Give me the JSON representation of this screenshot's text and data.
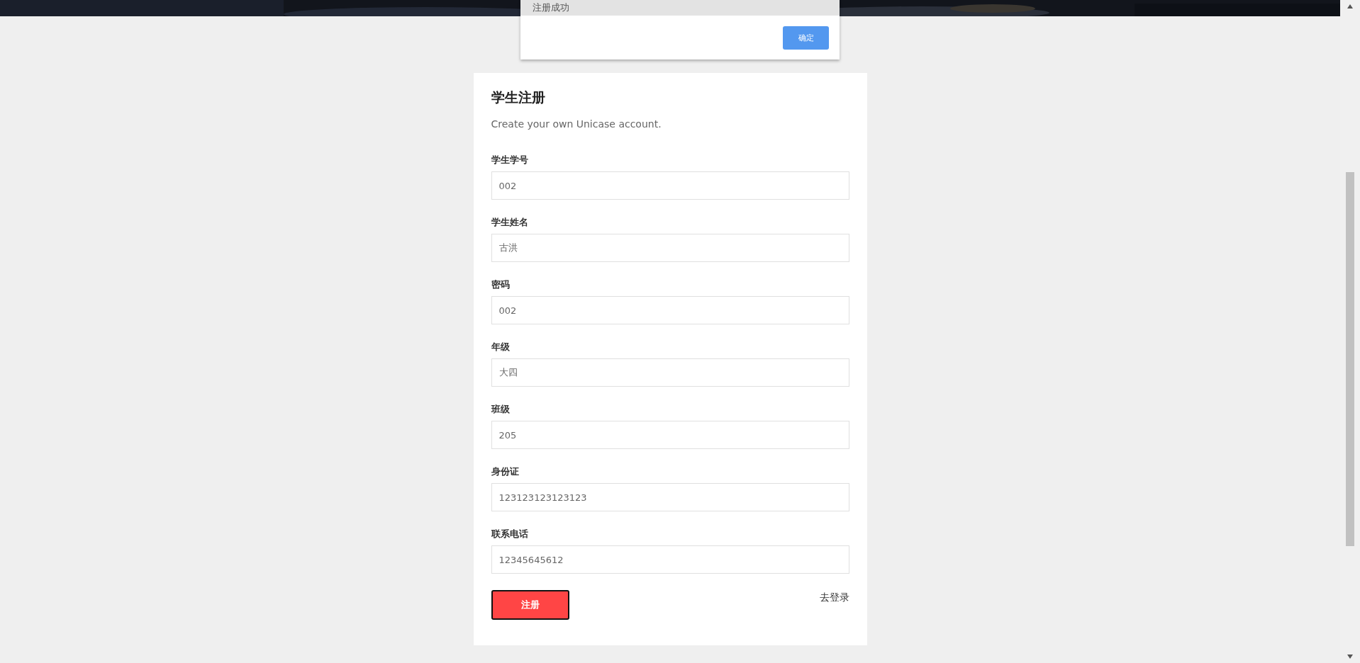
{
  "dialog": {
    "message": "注册成功",
    "button": "确定"
  },
  "form": {
    "title": "学生注册",
    "subtitle": "Create your own Unicase account.",
    "fields": [
      {
        "label": "学生学号",
        "value": "002"
      },
      {
        "label": "学生姓名",
        "value": "古洪"
      },
      {
        "label": "密码",
        "value": "002"
      },
      {
        "label": "年级",
        "value": "大四"
      },
      {
        "label": "班级",
        "value": "205"
      },
      {
        "label": "身份证",
        "value": "123123123123123"
      },
      {
        "label": "联系电话",
        "value": "12345645612"
      }
    ],
    "submit": "注册",
    "login_link": "去登录"
  }
}
